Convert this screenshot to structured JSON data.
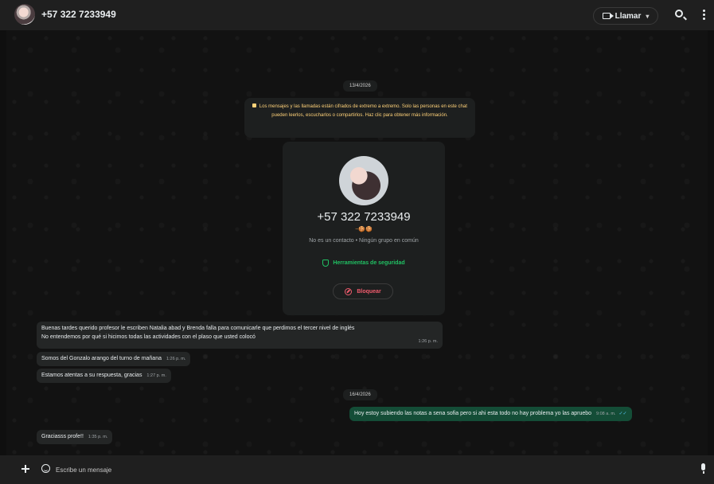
{
  "header": {
    "contact_name": "+57 322 7233949",
    "call_label": "Llamar",
    "icons": [
      "video-icon",
      "chevron-down-icon",
      "search-icon",
      "kebab-menu-icon"
    ]
  },
  "chat": {
    "date_1": "13/4/2026",
    "encryption_notice": "Los mensajes y las llamadas están cifrados de extremo a extremo. Solo las personas en este chat pueden leerlos, escucharlos o compartirlos. Haz clic para obtener más información.",
    "contact_card": {
      "number": "+57 322 7233949",
      "emoji_line": "~🍪🍪",
      "meta": "No es un contacto • Ningún grupo en común",
      "security_tools": "Herramientas de seguridad",
      "block_label": "Bloquear"
    },
    "messages": [
      {
        "text": "Buenas tardes querido profesor le escriben Natalia abad y Brenda falla para comunicarle que perdimos el tercer nivel de inglés",
        "text_2": "No entendemos por qué si hicimos todas las actividades con el plaso que usted colocó",
        "time": "1:26 p. m."
      },
      {
        "text": "Somos del Gonzalo arango del turno de mañana",
        "time": "1:26 p. m."
      },
      {
        "text": "Estamos atentas a su respuesta, gracias",
        "time": "1:27 p. m."
      }
    ],
    "date_2": "16/4/2026",
    "outgoing": {
      "text": "Hoy estoy subiendo las notas a sena sofia pero si ahi esta todo no hay problema yo las apruebo",
      "time": "9:08 a. m."
    },
    "last_message": {
      "text": "Graciasss profe!!",
      "time": "1:35 p. m."
    }
  },
  "composer": {
    "placeholder": "Escribe un mensaje"
  },
  "colors": {
    "accent_green": "#21c063",
    "block_red": "#f15c6d",
    "encryption_yellow": "#ffd279",
    "outgoing_bubble": "#144d37"
  }
}
